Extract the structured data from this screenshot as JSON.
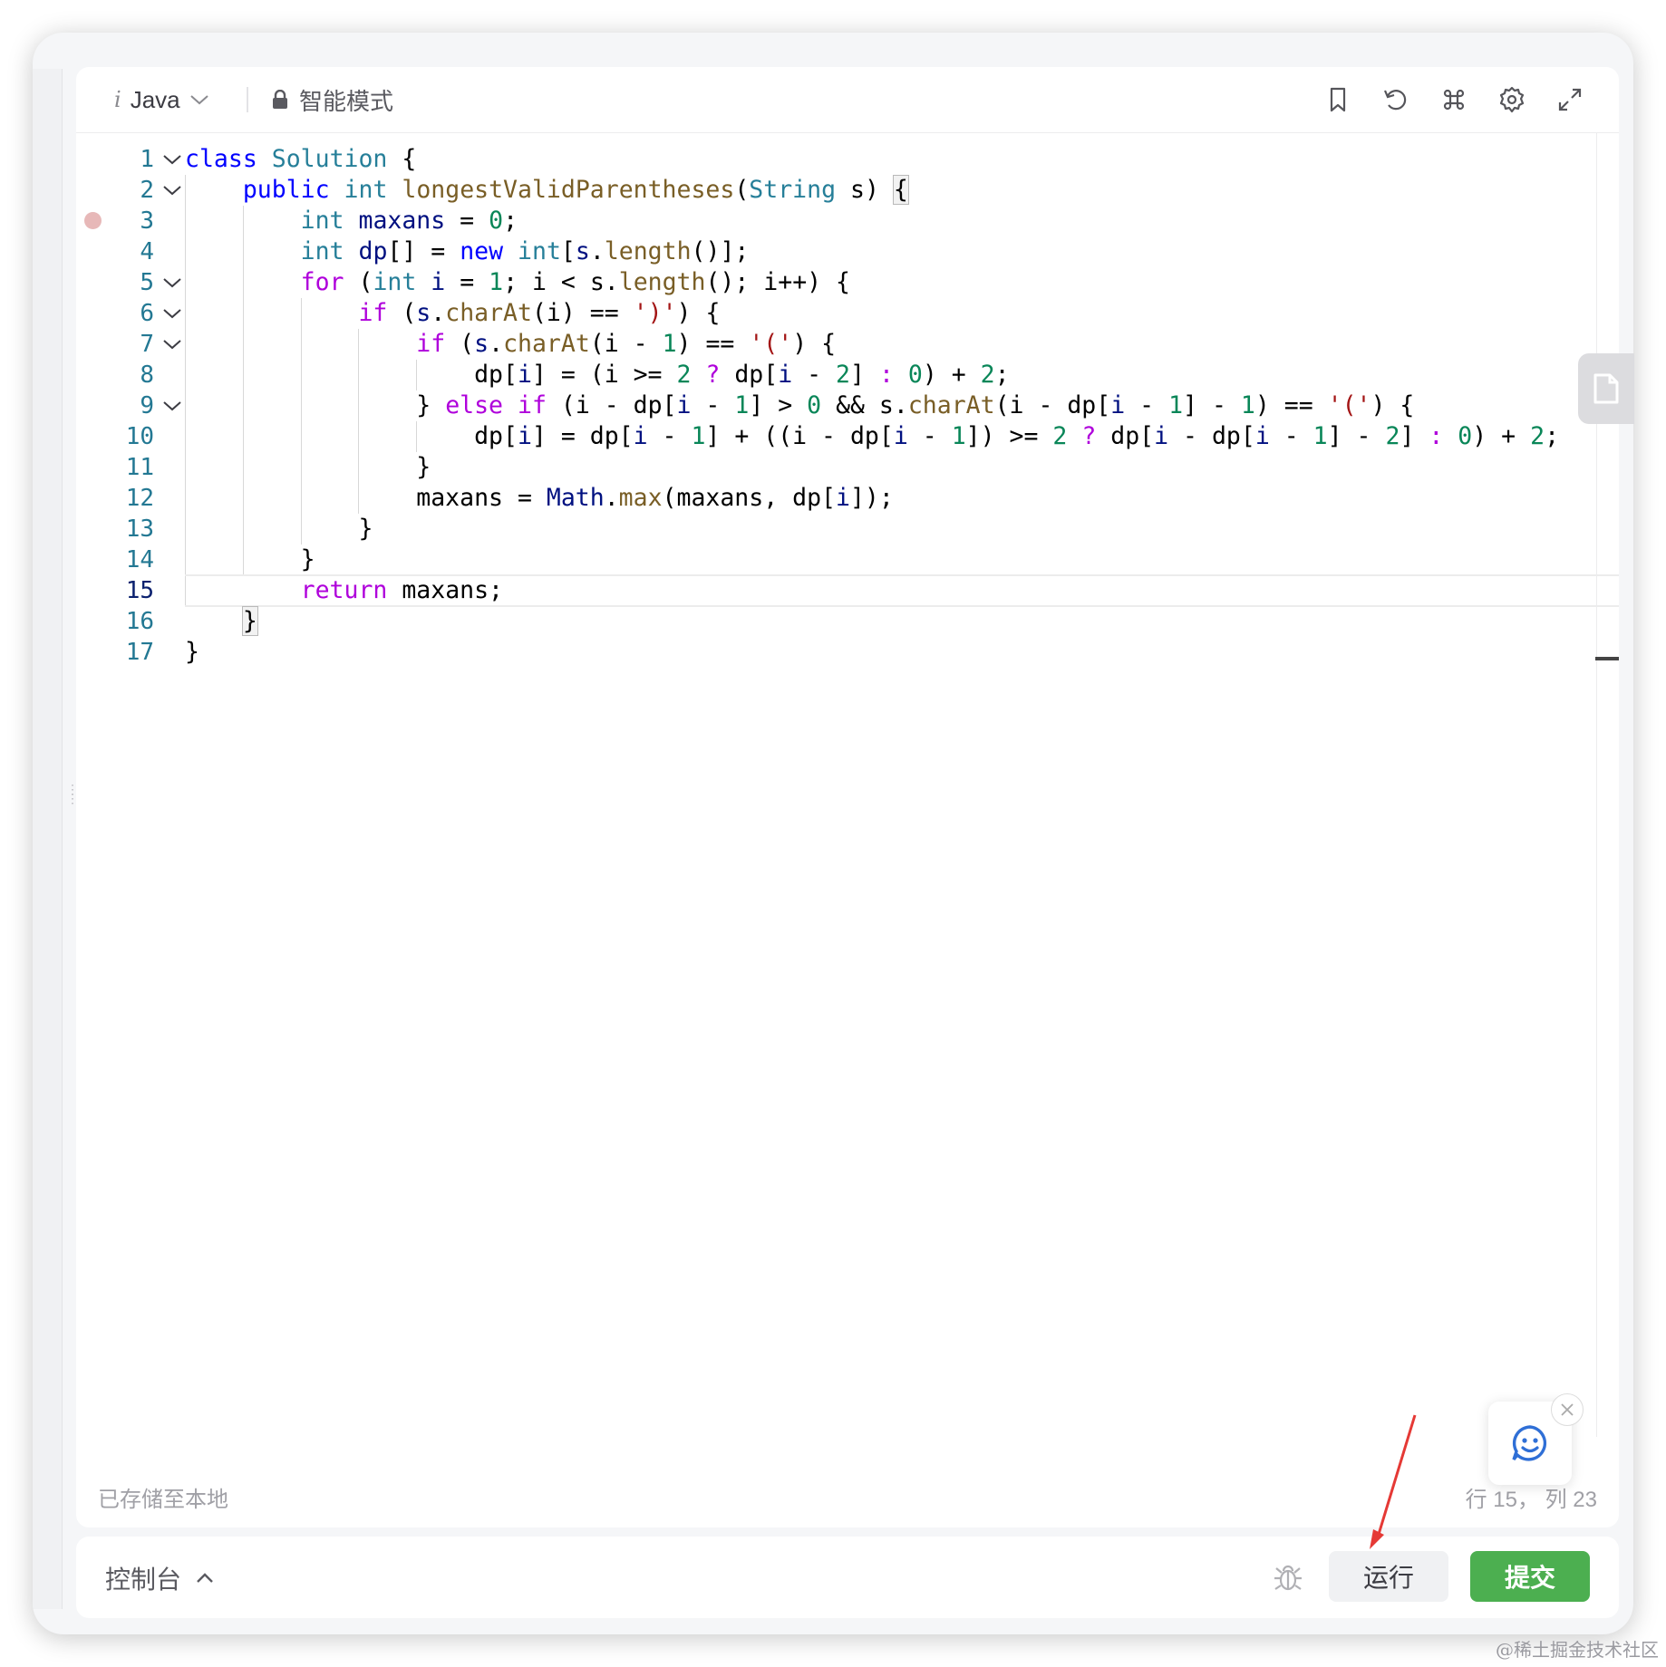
{
  "toolbar": {
    "language_prefix": "i",
    "language": "Java",
    "mode_label": "智能模式",
    "icons": [
      "bookmark-icon",
      "reset-icon",
      "shortcut-icon",
      "settings-icon",
      "fullscreen-icon"
    ]
  },
  "editor": {
    "active_line": 15,
    "breakpoint_line": 3,
    "foldable_lines": [
      1,
      2,
      5,
      6,
      7,
      9
    ],
    "lines": [
      {
        "n": "1"
      },
      {
        "n": "2"
      },
      {
        "n": "3"
      },
      {
        "n": "4"
      },
      {
        "n": "5"
      },
      {
        "n": "6"
      },
      {
        "n": "7"
      },
      {
        "n": "8"
      },
      {
        "n": "9"
      },
      {
        "n": "10"
      },
      {
        "n": "11"
      },
      {
        "n": "12"
      },
      {
        "n": "13"
      },
      {
        "n": "14"
      },
      {
        "n": "15"
      },
      {
        "n": "16"
      },
      {
        "n": "17"
      }
    ],
    "code": [
      "class Solution {",
      "    public int longestValidParentheses(String s) {",
      "        int maxans = 0;",
      "        int dp[] = new int[s.length()];",
      "        for (int i = 1; i < s.length(); i++) {",
      "            if (s.charAt(i) == ')') {",
      "                if (s.charAt(i - 1) == '(') {",
      "                    dp[i] = (i >= 2 ? dp[i - 2] : 0) + 2;",
      "                } else if (i - dp[i - 1] > 0 && s.charAt(i - dp[i - 1] - 1) == '(') {",
      "                    dp[i] = dp[i - 1] + ((i - dp[i - 1]) >= 2 ? dp[i - dp[i - 1] - 2] : 0) + 2;",
      "                }",
      "                maxans = Math.max(maxans, dp[i]);",
      "            }",
      "        }",
      "        return maxans;",
      "    }",
      "}"
    ]
  },
  "status": {
    "saved": "已存储至本地",
    "cursor": "行 15， 列 23"
  },
  "bottom": {
    "console_label": "控制台",
    "run_label": "运行",
    "submit_label": "提交"
  },
  "colors": {
    "submit": "#4caf50",
    "keyword": "#0000ff",
    "type": "#267f99",
    "control": "#af00db",
    "function": "#795e26",
    "number": "#098658",
    "string": "#a31515",
    "line_number": "#237893",
    "annotation_arrow": "#e53935"
  },
  "watermark": "@稀土掘金技术社区"
}
